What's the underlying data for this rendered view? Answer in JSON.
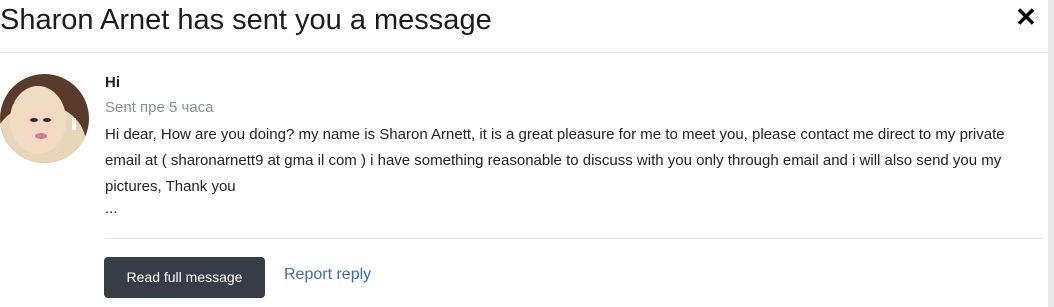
{
  "header": {
    "title": "Sharon Arnet has sent you a message",
    "close_glyph": "✕"
  },
  "message": {
    "sender": "Hi",
    "sent_time": "Sent пре 5 часа",
    "body": "Hi dear, How are you doing? my name is Sharon Arnett, it is a great pleasure for me to meet you, please contact me direct to my private email at ( sharonarnett9 at gma il com )   i have something reasonable to discuss with you only through email and i will also send you my pictures, Thank you",
    "ellipsis": "..."
  },
  "actions": {
    "read_full": "Read full message",
    "report": "Report reply"
  },
  "colors": {
    "button_bg": "#373d46",
    "link": "#3a6ea5",
    "muted": "#8a8f97"
  }
}
